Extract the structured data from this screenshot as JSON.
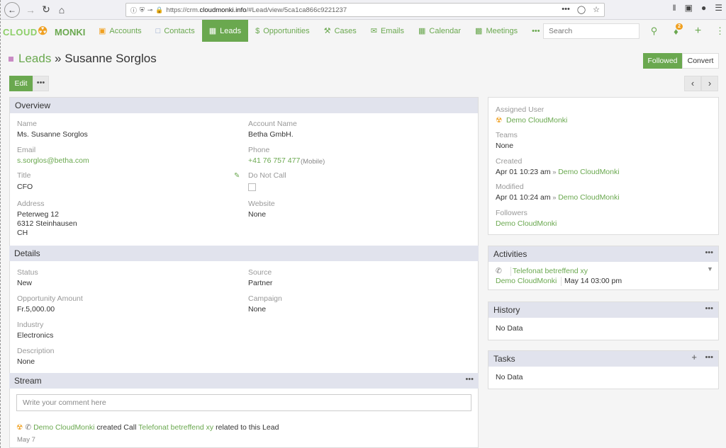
{
  "browser": {
    "url_prefix": "https://crm.",
    "url_domain": "cloudmonki.info",
    "url_suffix": "/#Lead/view/5ca1ca866c9221237"
  },
  "nav": {
    "logo_left": "CLOUD",
    "logo_right": "MONKI",
    "tabs": [
      {
        "label": "Accounts",
        "icon": "briefcase-icon"
      },
      {
        "label": "Contacts",
        "icon": "id-card-icon"
      },
      {
        "label": "Leads",
        "icon": "address-card-icon"
      },
      {
        "label": "Opportunities",
        "icon": "dollar-icon"
      },
      {
        "label": "Cases",
        "icon": "wrench-icon"
      },
      {
        "label": "Emails",
        "icon": "envelope-icon"
      },
      {
        "label": "Calendar",
        "icon": "calendar-icon"
      },
      {
        "label": "Meetings",
        "icon": "group-icon"
      }
    ],
    "more": "•••",
    "search_placeholder": "Search",
    "notif_count": "2"
  },
  "header": {
    "breadcrumb": "Leads",
    "separator": " » ",
    "title": "Susanne Sorglos",
    "followed": "Followed",
    "convert": "Convert",
    "edit": "Edit",
    "more": "•••"
  },
  "overview": {
    "title": "Overview",
    "name_label": "Name",
    "name": "Ms. Susanne Sorglos",
    "account_label": "Account Name",
    "account": "Betha GmbH.",
    "email_label": "Email",
    "email": "s.sorglos@betha.com",
    "phone_label": "Phone",
    "phone": "+41 76 757 477",
    "phone_type": "(Mobile)",
    "title_label": "Title",
    "title_value": "CFO",
    "dnc_label": "Do Not Call",
    "address_label": "Address",
    "address_line1": "Peterweg 12",
    "address_line2": "6312 Steinhausen",
    "address_line3": "CH",
    "website_label": "Website",
    "website": "None"
  },
  "details": {
    "title": "Details",
    "status_label": "Status",
    "status": "New",
    "source_label": "Source",
    "source": "Partner",
    "amount_label": "Opportunity Amount",
    "amount": "Fr.5,000.00",
    "campaign_label": "Campaign",
    "campaign": "None",
    "industry_label": "Industry",
    "industry": "Electronics",
    "description_label": "Description",
    "description": "None"
  },
  "stream": {
    "title": "Stream",
    "placeholder": "Write your comment here",
    "user": "Demo CloudMonki",
    "action": " created Call ",
    "call": "Telefonat betreffend xy",
    "tail": " related to this Lead",
    "date": "May 7"
  },
  "side": {
    "assigned_label": "Assigned User",
    "assigned": "Demo CloudMonki",
    "teams_label": "Teams",
    "teams": "None",
    "created_label": "Created",
    "created": "Apr 01 10:23 am",
    "created_by": "Demo CloudMonki",
    "modified_label": "Modified",
    "modified": "Apr 01 10:24 am",
    "modified_by": "Demo CloudMonki",
    "followers_label": "Followers",
    "followers": "Demo CloudMonki",
    "sep": " » "
  },
  "activities": {
    "title": "Activities",
    "item": "Telefonat betreffend xy",
    "user": "Demo CloudMonki",
    "date": "May 14 03:00 pm"
  },
  "history": {
    "title": "History",
    "empty": "No Data"
  },
  "tasks": {
    "title": "Tasks",
    "empty": "No Data"
  }
}
